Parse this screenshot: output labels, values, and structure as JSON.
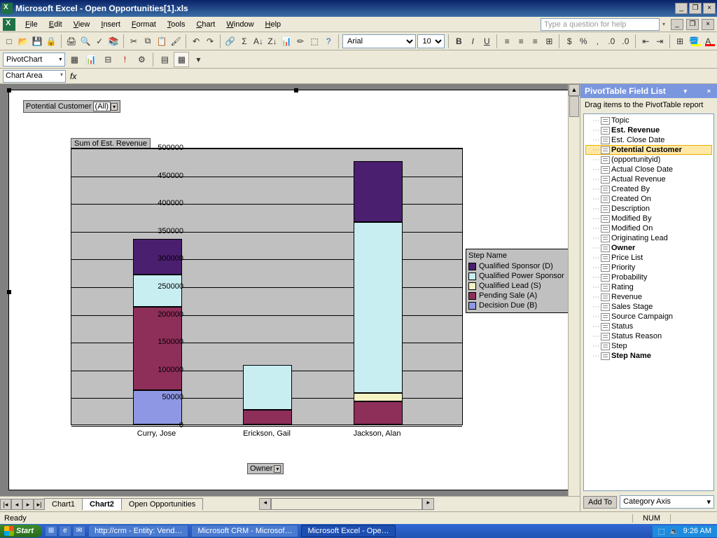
{
  "titlebar": {
    "title": "Microsoft Excel - Open Opportunities[1].xls"
  },
  "menu": {
    "items": [
      "File",
      "Edit",
      "View",
      "Insert",
      "Format",
      "Tools",
      "Chart",
      "Window",
      "Help"
    ],
    "help_placeholder": "Type a question for help"
  },
  "formatting": {
    "font": "Arial",
    "size": "10"
  },
  "pivot_toolbar": {
    "label": "PivotChart"
  },
  "namebox": {
    "value": "Chart Area"
  },
  "page_filter": {
    "field": "Potential Customer",
    "value": "(All)"
  },
  "chart_title": "Sum of Est. Revenue",
  "axis_title": "Owner",
  "legend": {
    "title": "Step Name",
    "items": [
      {
        "label": "Qualified Sponsor (D)",
        "color": "#4b1f6f"
      },
      {
        "label": "Qualified Power Sponsor",
        "color": "#c8eef2"
      },
      {
        "label": "Qualified Lead (S)",
        "color": "#f5f3c3"
      },
      {
        "label": "Pending Sale (A)",
        "color": "#8e2f5a"
      },
      {
        "label": "Decision Due (B)",
        "color": "#8e97e3"
      }
    ]
  },
  "chart_data": {
    "type": "bar",
    "stacked": true,
    "categories": [
      "Curry, Jose",
      "Erickson, Gail",
      "Jackson, Alan"
    ],
    "series": [
      {
        "name": "Decision Due (B)",
        "color": "#8e97e3",
        "values": [
          62000,
          0,
          0
        ]
      },
      {
        "name": "Pending Sale (A)",
        "color": "#8e2f5a",
        "values": [
          150000,
          27000,
          42000
        ]
      },
      {
        "name": "Qualified Lead (S)",
        "color": "#f5f3c3",
        "values": [
          0,
          0,
          15000
        ]
      },
      {
        "name": "Qualified Power Sponsor",
        "color": "#c8eef2",
        "values": [
          58000,
          80000,
          308000
        ]
      },
      {
        "name": "Qualified Sponsor (D)",
        "color": "#4b1f6f",
        "values": [
          65000,
          0,
          110000
        ]
      }
    ],
    "ylabel": "Sum of Est. Revenue",
    "xlabel": "Owner",
    "ylim": [
      0,
      500000
    ],
    "ytick_step": 50000
  },
  "sheet_tabs": {
    "tabs": [
      "Chart1",
      "Chart2",
      "Open Opportunities"
    ],
    "active": 1
  },
  "field_list": {
    "title": "PivotTable Field List",
    "instruction": "Drag items to the PivotTable report",
    "fields": [
      {
        "name": "Topic",
        "bold": false
      },
      {
        "name": "Est. Revenue",
        "bold": true
      },
      {
        "name": "Est. Close Date",
        "bold": false
      },
      {
        "name": "Potential Customer",
        "bold": true,
        "selected": true
      },
      {
        "name": "(opportunityid)",
        "bold": false
      },
      {
        "name": "Actual Close Date",
        "bold": false
      },
      {
        "name": "Actual Revenue",
        "bold": false
      },
      {
        "name": "Created By",
        "bold": false
      },
      {
        "name": "Created On",
        "bold": false
      },
      {
        "name": "Description",
        "bold": false
      },
      {
        "name": "Modified By",
        "bold": false
      },
      {
        "name": "Modified On",
        "bold": false
      },
      {
        "name": "Originating Lead",
        "bold": false
      },
      {
        "name": "Owner",
        "bold": true
      },
      {
        "name": "Price List",
        "bold": false
      },
      {
        "name": "Priority",
        "bold": false
      },
      {
        "name": "Probability",
        "bold": false
      },
      {
        "name": "Rating",
        "bold": false
      },
      {
        "name": "Revenue",
        "bold": false
      },
      {
        "name": "Sales Stage",
        "bold": false
      },
      {
        "name": "Source Campaign",
        "bold": false
      },
      {
        "name": "Status",
        "bold": false
      },
      {
        "name": "Status Reason",
        "bold": false
      },
      {
        "name": "Step",
        "bold": false
      },
      {
        "name": "Step Name",
        "bold": true
      }
    ],
    "add_button": "Add To",
    "axis_select": "Category Axis"
  },
  "status": {
    "ready": "Ready",
    "numlock": "NUM"
  },
  "taskbar": {
    "start": "Start",
    "buttons": [
      {
        "label": "http://crm - Entity: Vend…",
        "active": false
      },
      {
        "label": "Microsoft CRM - Microsof…",
        "active": false
      },
      {
        "label": "Microsoft Excel - Ope…",
        "active": true
      }
    ],
    "clock": "9:26 AM"
  }
}
